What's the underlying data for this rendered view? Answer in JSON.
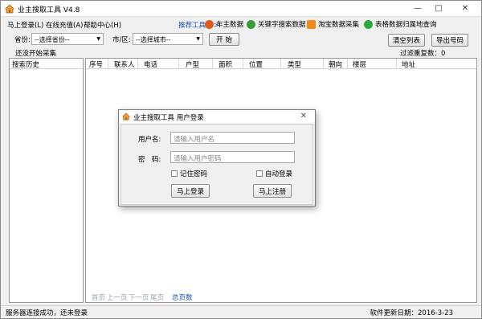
{
  "window": {
    "title": "业主搜取工具 V4.8"
  },
  "menu": {
    "items": [
      "马上登录(L)",
      "在线充值(A)",
      "帮助中心(H)"
    ]
  },
  "promo": {
    "label": "推荐工具 >>",
    "items": [
      {
        "label": "车主数据",
        "color": "#e05a1c"
      },
      {
        "label": "关键字搜索数据",
        "color": "#3a9b3a"
      },
      {
        "label": "淘宝数据采集",
        "color": "#f08a1a"
      },
      {
        "label": "表格数据归属地查询",
        "color": "#2aa83a"
      }
    ]
  },
  "filters": {
    "province_label": "省份:",
    "province_value": "--选择省份--",
    "city_label": "市/区:",
    "city_value": "--选择城市--",
    "start_label": "开 始",
    "clear_label": "清空列表",
    "export_label": "导出号码"
  },
  "status": {
    "collect": "还没开始采集",
    "filter_dup": "过滤重复数：0"
  },
  "left_panel": {
    "header": "搜索历史"
  },
  "grid": {
    "columns": [
      "序号",
      "联系人",
      "电话",
      "户型",
      "面积",
      "位置",
      "类型",
      "朝向",
      "楼层",
      "地址"
    ]
  },
  "pager": {
    "first": "首页",
    "prev": "上一页",
    "next": "下一页",
    "last": "尾页",
    "total": "总页数"
  },
  "statusbar": {
    "left": "服务器连接成功，还未登录",
    "right": "软件更新日期：2016-3-23"
  },
  "dialog": {
    "title": "业主搜取工具 用户登录",
    "username_label": "用户名:",
    "username_placeholder": "请输入用户名",
    "password_label": "密　码:",
    "password_placeholder": "请输入用户密码",
    "remember_label": "记住密码",
    "autologin_label": "自动登录",
    "login_label": "马上登录",
    "register_label": "马上注册"
  }
}
